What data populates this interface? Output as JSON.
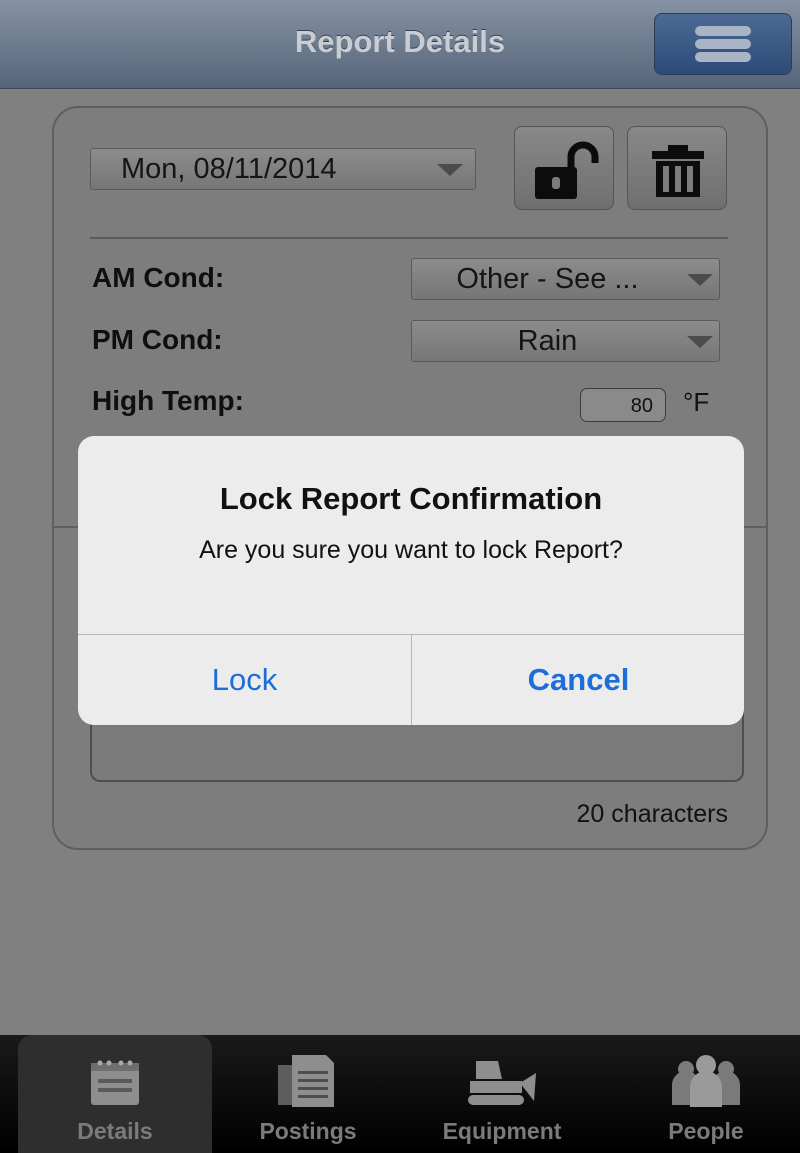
{
  "navbar": {
    "title": "Report Details"
  },
  "report": {
    "date": "Mon, 08/11/2014",
    "am_label": "AM Cond:",
    "am_value": "Other - See ...",
    "pm_label": "PM Cond:",
    "pm_value": "Rain",
    "high_temp_label": "High Temp:",
    "high_temp_value": "80",
    "temp_unit": "°F",
    "char_count": "20 characters"
  },
  "alert": {
    "title": "Lock Report Confirmation",
    "message": "Are you sure you want to lock Report?",
    "lock_label": "Lock",
    "cancel_label": "Cancel",
    "button_color": "#1e6ed8"
  },
  "tabs": [
    {
      "label": "Details",
      "icon": "details-icon",
      "active": true
    },
    {
      "label": "Postings",
      "icon": "postings-icon",
      "active": false
    },
    {
      "label": "Equipment",
      "icon": "equipment-icon",
      "active": false
    },
    {
      "label": "People",
      "icon": "people-icon",
      "active": false
    }
  ]
}
